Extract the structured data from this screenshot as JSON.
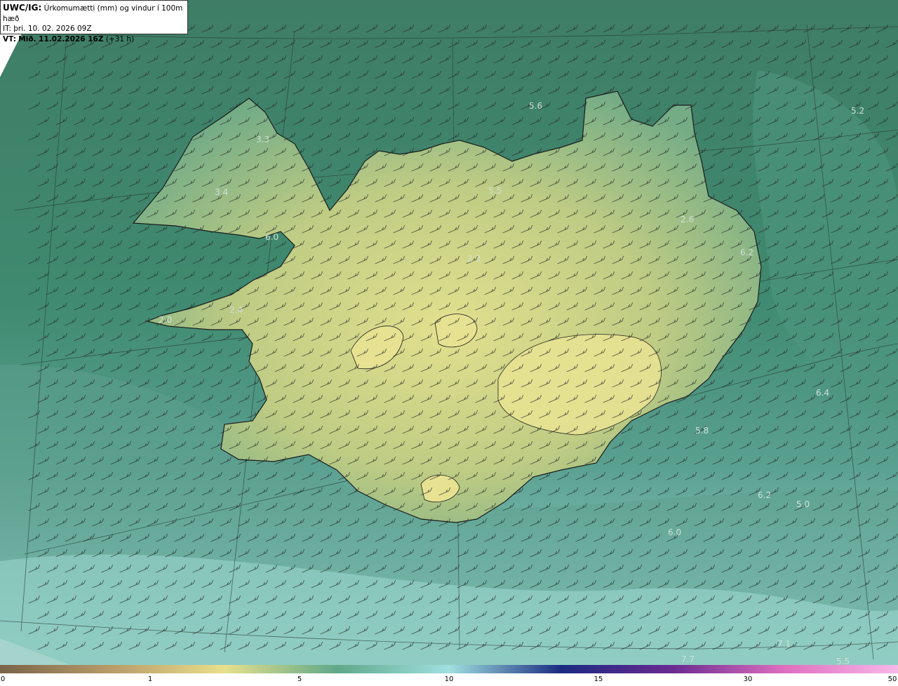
{
  "header": {
    "product_code": "UWC/IG:",
    "title": "Úrkomumætti (mm) og vindur í 100m hæð",
    "it_label": "IT:",
    "it_value": "þri. 10. 02. 2026 09Z",
    "vt_label": "VT:",
    "vt_value": "Mið. 11.02.2026 16Z",
    "vt_offset": "(+31 h)"
  },
  "colorbar": {
    "ticks": [
      "0",
      "1",
      "5",
      "10",
      "15",
      "30",
      "50"
    ],
    "stops": [
      "#7a6448",
      "#b89c6a",
      "#e8e08c",
      "#5fa88a",
      "#9fe0e0",
      "#1a2a80",
      "#6a2a90",
      "#e070c0",
      "#f6b8e8"
    ]
  },
  "value_labels": [
    "5.6",
    "5.2",
    "3.3",
    "3.4",
    "5.5",
    "2.6",
    "6.0",
    "6.2",
    "2.3",
    "2.4",
    "2.0",
    "6.4",
    "5.8",
    "6.2",
    "5.0",
    "6.0",
    "7.1",
    "7.7",
    "5.5"
  ],
  "colors": {
    "sea": "#3c7c66",
    "sea_light": "#8cc8c0",
    "land_low": "#6aa482",
    "land_high": "#e2e08e",
    "coast": "#1a1a1a"
  }
}
